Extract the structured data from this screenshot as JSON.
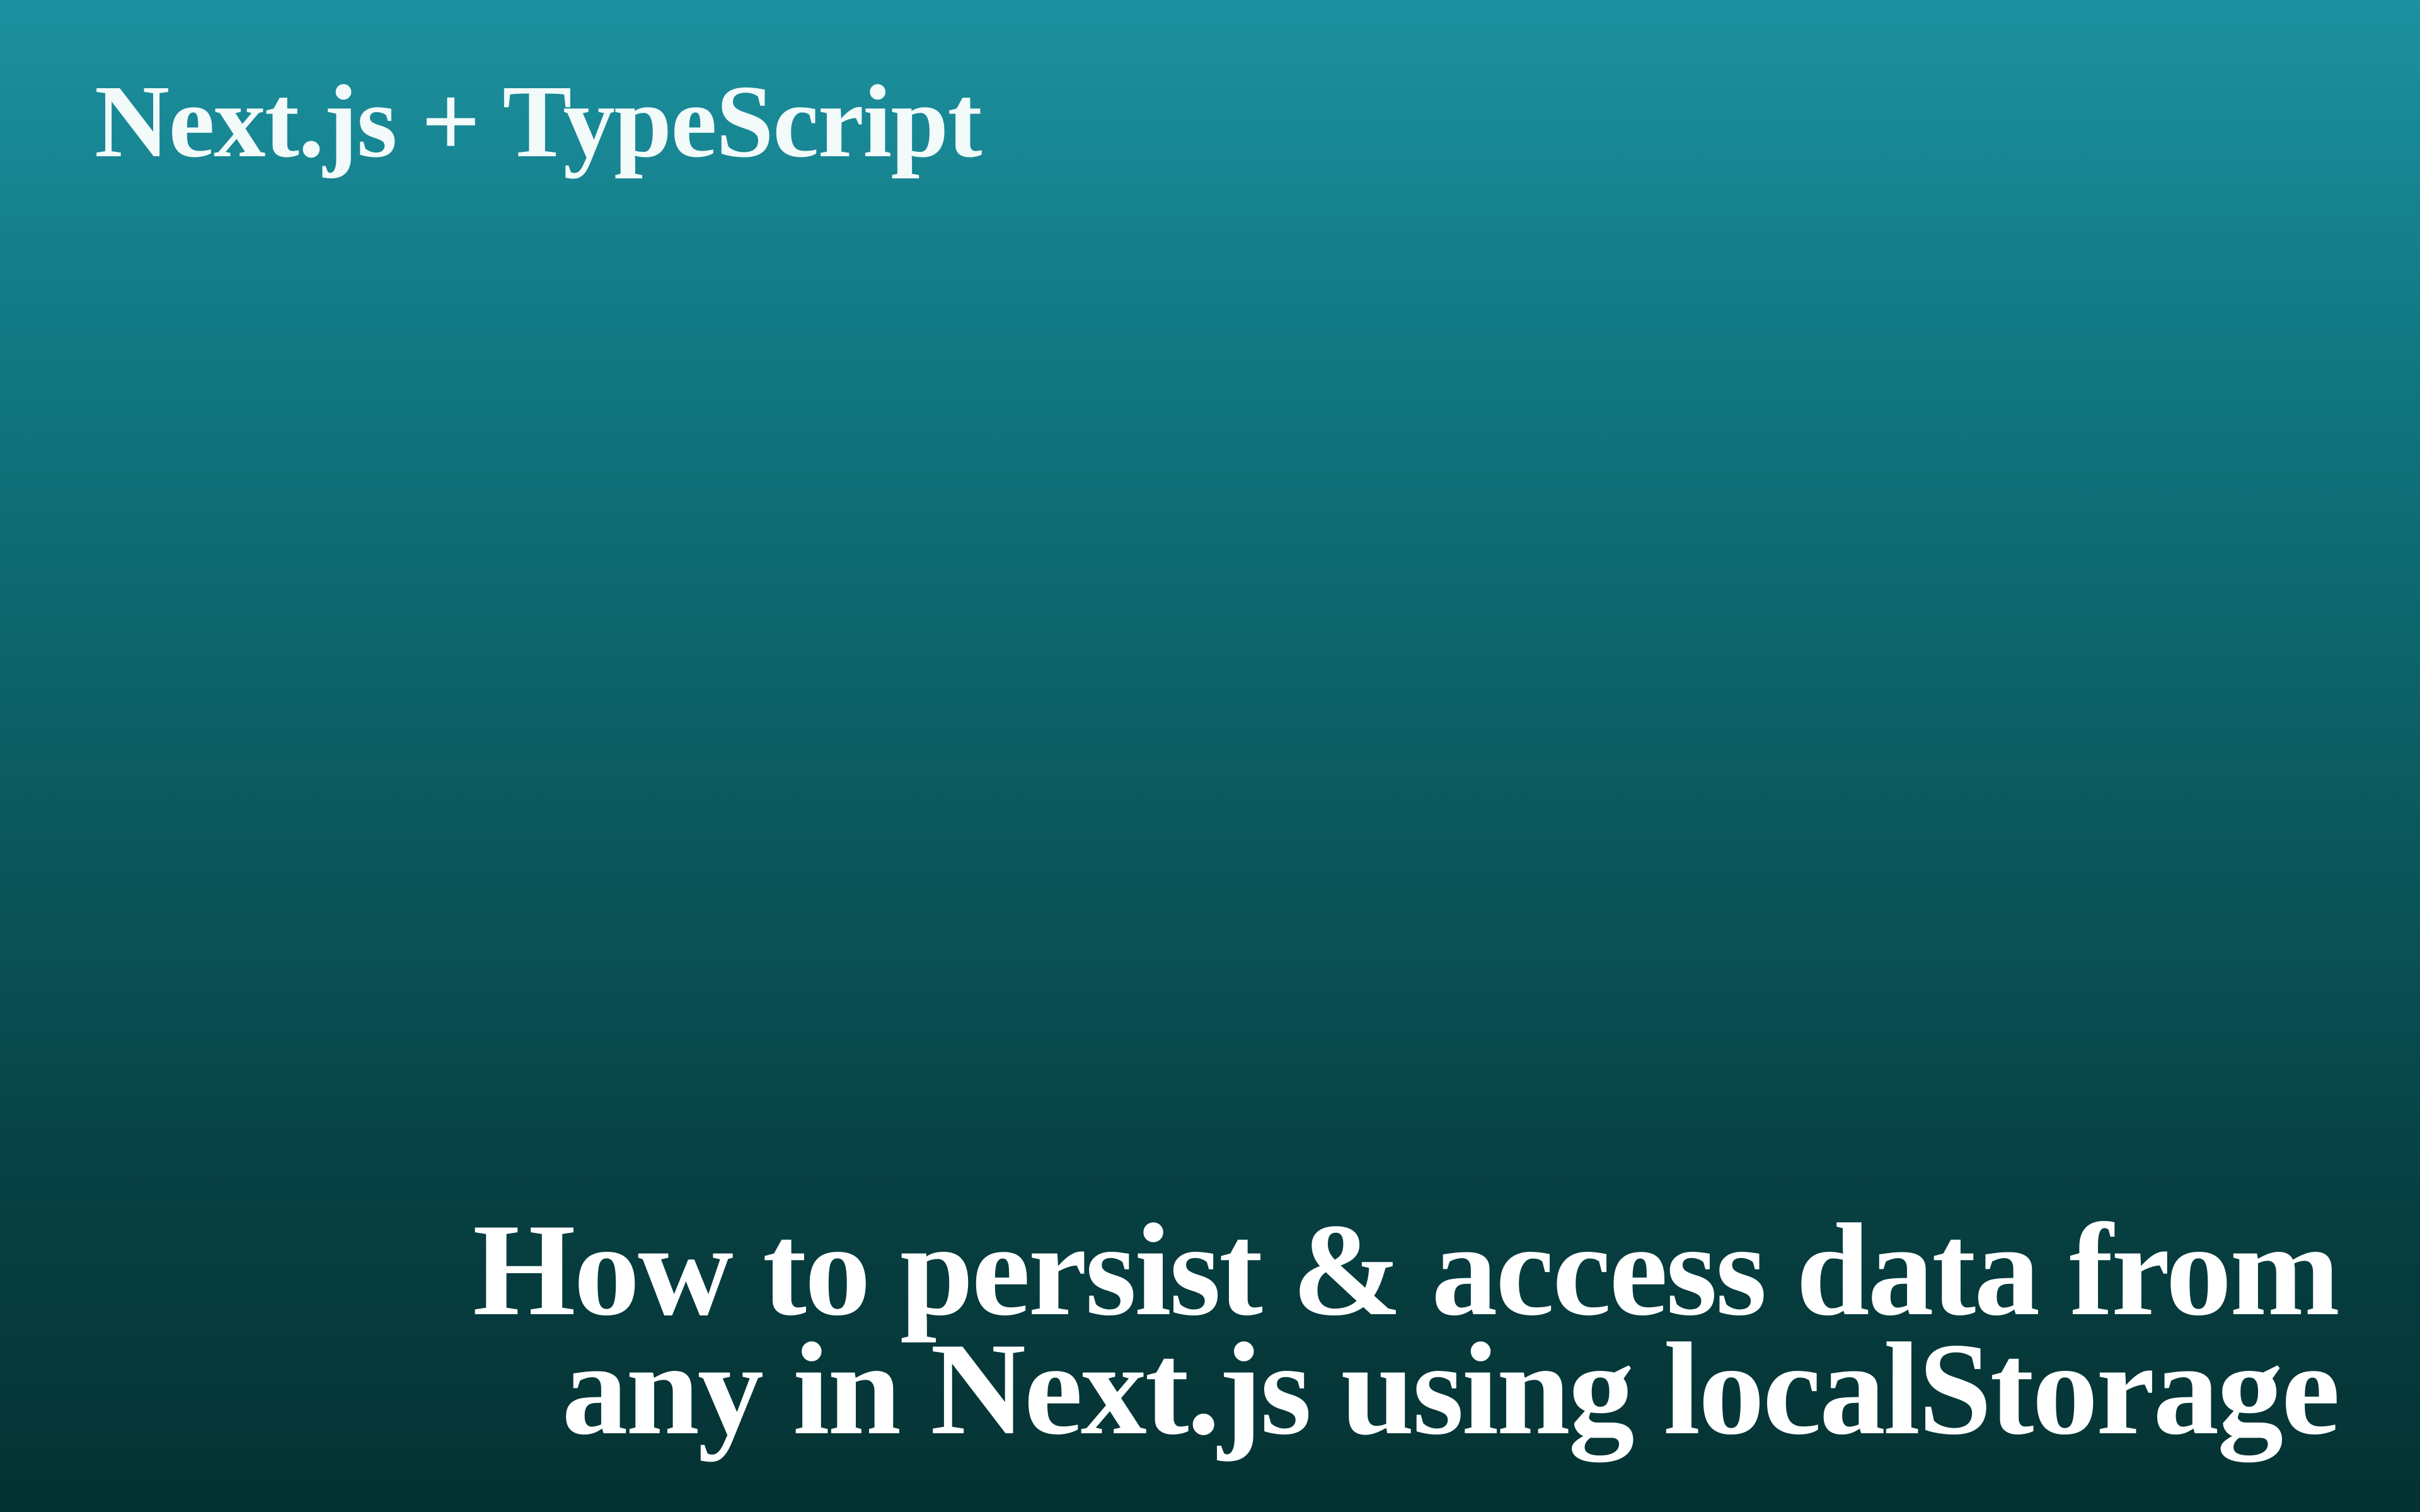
{
  "overline": "Next.js + TypeScript",
  "headline": "How to persist & access data from any in Next.js using localStorage"
}
